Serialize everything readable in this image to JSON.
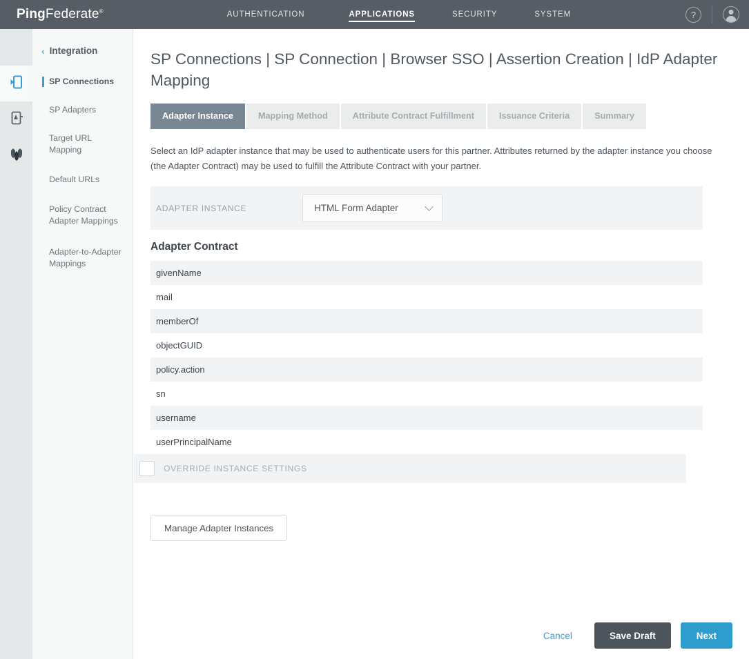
{
  "header": {
    "brand_bold": "Ping",
    "brand_light": "Federate",
    "brand_reg": "®",
    "nav": [
      {
        "label": "AUTHENTICATION",
        "active": false
      },
      {
        "label": "APPLICATIONS",
        "active": true
      },
      {
        "label": "SECURITY",
        "active": false
      },
      {
        "label": "SYSTEM",
        "active": false
      }
    ],
    "help_icon": "question-mark-circle-icon",
    "user_icon": "user-avatar-icon"
  },
  "rail": {
    "icons": [
      {
        "name": "sp-connections-icon",
        "active": true
      },
      {
        "name": "sp-adapters-icon",
        "active": false
      },
      {
        "name": "target-url-mapping-icon",
        "active": false
      }
    ]
  },
  "sidebar": {
    "back_chevron": "‹",
    "heading": "Integration",
    "items": [
      {
        "label": "SP Connections",
        "active": true
      },
      {
        "label": "SP Adapters",
        "active": false
      },
      {
        "label": "Target URL Mapping",
        "active": false
      },
      {
        "label": "Default URLs",
        "active": false
      },
      {
        "label": "Policy Contract Adapter Mappings",
        "active": false
      },
      {
        "label": "Adapter-to-Adapter Mappings",
        "active": false
      }
    ]
  },
  "main": {
    "page_title": "SP Connections | SP Connection | Browser SSO | Assertion Creation | IdP Adapter Mapping",
    "tabs": [
      {
        "label": "Adapter Instance",
        "active": true
      },
      {
        "label": "Mapping Method",
        "active": false
      },
      {
        "label": "Attribute Contract Fulfillment",
        "active": false
      },
      {
        "label": "Issuance Criteria",
        "active": false
      },
      {
        "label": "Summary",
        "active": false
      }
    ],
    "description": "Select an IdP adapter instance that may be used to authenticate users for this partner. Attributes returned by the adapter instance you choose (the Adapter Contract) may be used to fulfill the Attribute Contract with your partner.",
    "adapter_instance": {
      "label": "ADAPTER INSTANCE",
      "selected": "HTML Form Adapter",
      "chevron_icon": "chevron-down-icon"
    },
    "adapter_contract": {
      "title": "Adapter Contract",
      "rows": [
        "givenName",
        "mail",
        "memberOf",
        "objectGUID",
        "policy.action",
        "sn",
        "username",
        "userPrincipalName"
      ]
    },
    "override": {
      "label": "OVERRIDE INSTANCE SETTINGS",
      "checked": false
    },
    "manage_button": "Manage Adapter Instances"
  },
  "actions": {
    "cancel": "Cancel",
    "save_draft": "Save Draft",
    "next": "Next"
  },
  "colors": {
    "header_bg": "#565d64",
    "accent_blue": "#3b9dd2",
    "next_blue": "#2e9ccc",
    "tab_active": "#798795",
    "row_alt": "#f2f3f4"
  }
}
